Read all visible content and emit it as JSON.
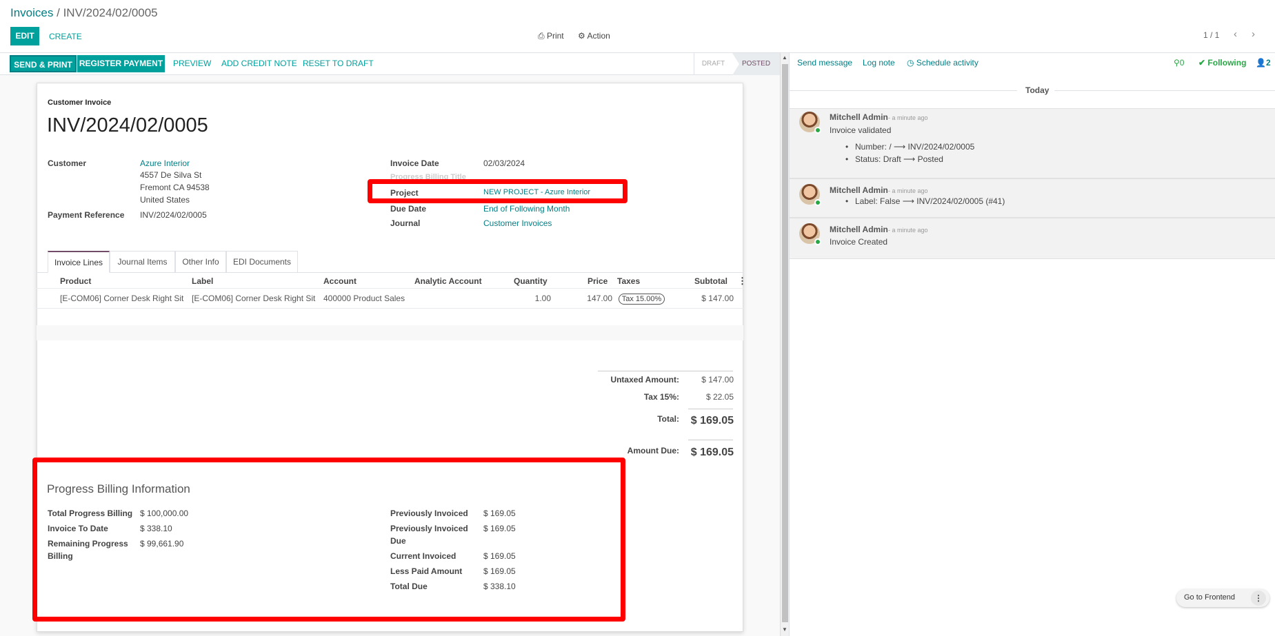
{
  "breadcrumb": {
    "parent": "Invoices",
    "separator": "/",
    "current": "INV/2024/02/0005"
  },
  "toolbar": {
    "edit": "EDIT",
    "create": "CREATE",
    "print": "Print",
    "action": "Action",
    "print_icon": "printer-icon",
    "action_icon": "gear-icon"
  },
  "pager": {
    "value": "1 / 1",
    "prev": "‹",
    "next": "›"
  },
  "statusbar": {
    "send_print": "SEND & PRINT",
    "register_payment": "REGISTER PAYMENT",
    "preview": "PREVIEW",
    "add_credit_note": "ADD CREDIT NOTE",
    "reset_to_draft": "RESET TO DRAFT",
    "states": [
      "DRAFT",
      "POSTED"
    ],
    "active_state": "POSTED"
  },
  "invoice": {
    "type": "Customer Invoice",
    "number": "INV/2024/02/0005",
    "customer_label": "Customer",
    "customer_name": "Azure Interior",
    "address_1": "4557 De Silva St",
    "address_2": "Fremont CA 94538",
    "address_3": "United States",
    "payment_ref_label": "Payment Reference",
    "payment_ref": "INV/2024/02/0005",
    "invoice_date_label": "Invoice Date",
    "invoice_date": "02/03/2024",
    "progress_title_label": "Progress Billing Title",
    "project_label": "Project",
    "project": "NEW PROJECT - Azure Interior",
    "due_date_label": "Due Date",
    "due_date": "End of Following Month",
    "journal_label": "Journal",
    "journal": "Customer Invoices"
  },
  "tabs": [
    "Invoice Lines",
    "Journal Items",
    "Other Info",
    "EDI Documents"
  ],
  "lines": {
    "headers": [
      "Product",
      "Label",
      "Account",
      "Analytic Account",
      "Quantity",
      "Price",
      "Taxes",
      "Subtotal"
    ],
    "rows": [
      {
        "product": "[E-COM06] Corner Desk Right Sit",
        "label": "[E-COM06] Corner Desk Right Sit",
        "account": "400000 Product Sales",
        "analytic": "",
        "quantity": "1.00",
        "price": "147.00",
        "tax": "Tax 15.00%",
        "subtotal": "$ 147.00"
      }
    ]
  },
  "totals": {
    "untaxed_label": "Untaxed Amount:",
    "untaxed": "$ 147.00",
    "tax_label": "Tax 15%:",
    "tax": "$ 22.05",
    "total_label": "Total:",
    "total": "$ 169.05",
    "due_label": "Amount Due:",
    "due": "$ 169.05"
  },
  "progress": {
    "title": "Progress Billing Information",
    "total_progress_label": "Total Progress Billing",
    "total_progress": "$ 100,000.00",
    "invoice_to_date_label": "Invoice To Date",
    "invoice_to_date": "$ 338.10",
    "remaining_label_1": "Remaining Progress",
    "remaining_label_2": "Billing",
    "remaining": "$ 99,661.90",
    "prev_invoiced_label": "Previously Invoiced",
    "prev_invoiced": "$ 169.05",
    "prev_invoiced_due_label_1": "Previously Invoiced",
    "prev_invoiced_due_label_2": "Due",
    "prev_invoiced_due": "$ 169.05",
    "current_invoiced_label": "Current Invoiced",
    "current_invoiced": "$ 169.05",
    "less_paid_label": "Less Paid Amount",
    "less_paid": "$ 169.05",
    "total_due_label": "Total Due",
    "total_due": "$ 338.10"
  },
  "chatter": {
    "send_message": "Send message",
    "log_note": "Log note",
    "schedule_activity": "Schedule activity",
    "attachments": "0",
    "following": "Following",
    "followers": "2",
    "today": "Today",
    "messages": [
      {
        "author": "Mitchell Admin",
        "when": "- a minute ago",
        "body": "Invoice validated",
        "bullets": [
          "Number: / ⟶ INV/2024/02/0005",
          "Status: Draft ⟶ Posted"
        ]
      },
      {
        "author": "Mitchell Admin",
        "when": "- a minute ago",
        "body": "",
        "bullets": [
          "Label: False ⟶ INV/2024/02/0005 (#41)"
        ]
      },
      {
        "author": "Mitchell Admin",
        "when": "- a minute ago",
        "body": "Invoice Created",
        "bullets": []
      }
    ]
  },
  "frontend": {
    "label": "Go to Frontend",
    "menu": "⋮"
  },
  "colors": {
    "primary": "#00a09d",
    "link": "#017e84",
    "accent": "#714b67",
    "highlight": "#ff0000"
  }
}
